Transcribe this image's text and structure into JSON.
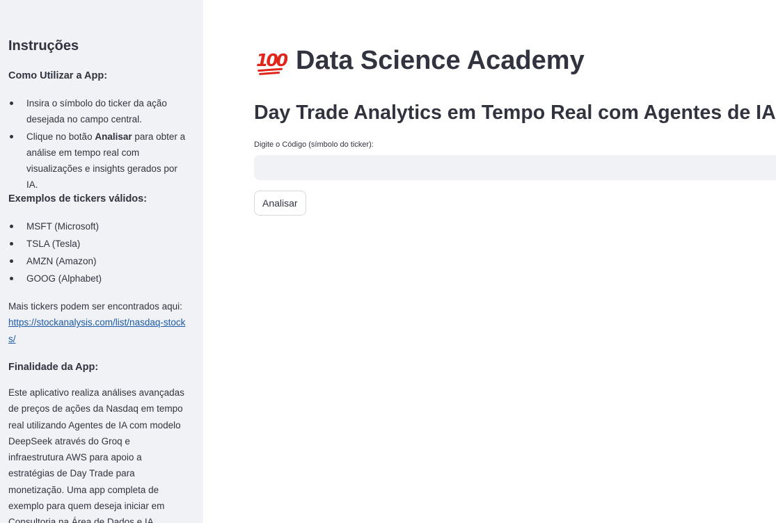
{
  "sidebar": {
    "heading": "Instruções",
    "how_to_use": {
      "heading": "Como Utilizar a App:",
      "items": [
        {
          "text": "Insira o símbolo do ticker da ação desejada no campo central."
        },
        {
          "pre": "Clique no botão ",
          "bold": "Analisar",
          "post": " para obter a análise em tempo real com visualizações e insights gerados por IA."
        }
      ]
    },
    "examples": {
      "heading": "Exemplos de tickers válidos:",
      "items": [
        "MSFT (Microsoft)",
        "TSLA (Tesla)",
        "AMZN (Amazon)",
        "GOOG (Alphabet)"
      ]
    },
    "more_tickers": {
      "text": "Mais tickers podem ser encontrados aqui:",
      "link": "https://stockanalysis.com/list/nasdaq-stocks/"
    },
    "purpose": {
      "heading": "Finalidade da App:",
      "text": "Este aplicativo realiza análises avançadas de preços de ações da Nasdaq em tempo real utilizando Agentes de IA com modelo DeepSeek através do Groq e infraestrutura AWS para apoio a estratégias de Day Trade para monetização. Uma app completa de exemplo para quem deseja iniciar em Consultoria na Área de Dados e IA."
    }
  },
  "main": {
    "emoji": "💯",
    "title": "Data Science Academy",
    "subtitle": "Day Trade Analytics em Tempo Real com Agentes de IA",
    "ticker_input": {
      "label": "Digite o Código (símbolo do ticker):",
      "value": "",
      "placeholder": ""
    },
    "analyze_button": "Analisar"
  },
  "colors": {
    "sidebar_bg": "#f0f2f6",
    "text": "#31333f",
    "link": "#1a5aa6",
    "emoji_red": "#e0261b"
  }
}
